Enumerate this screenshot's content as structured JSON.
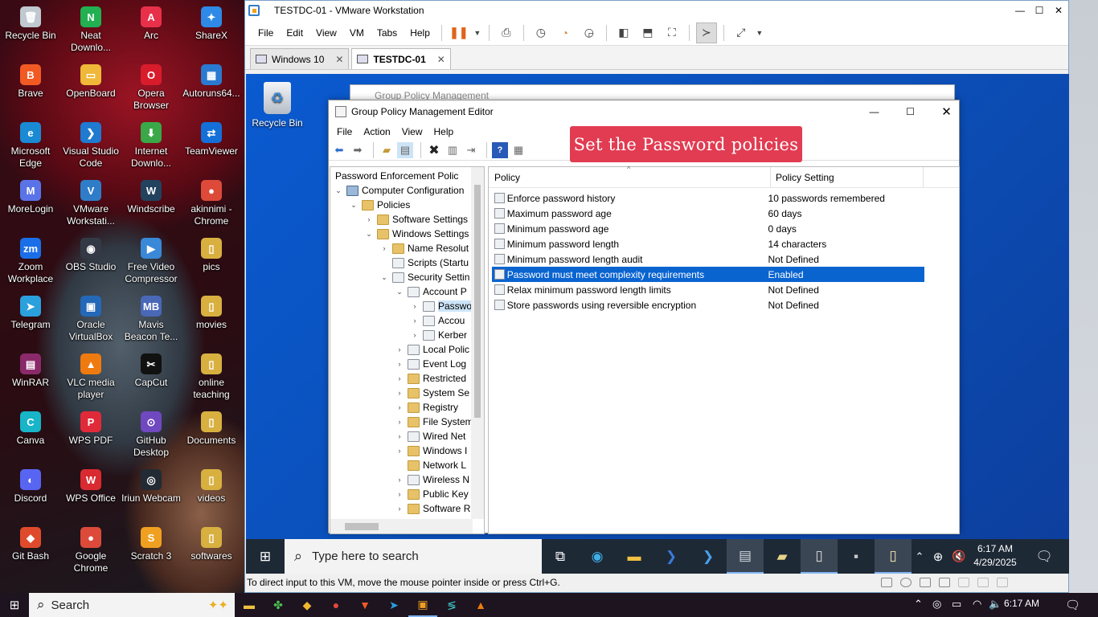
{
  "host_desktop": {
    "icons": [
      {
        "label": "Recycle Bin",
        "glyph": "🗑",
        "color": "#c0c8d0"
      },
      {
        "label": "Neat Downlo...",
        "glyph": "N",
        "color": "#22b052"
      },
      {
        "label": "Arc",
        "glyph": "A",
        "color": "#e8304a"
      },
      {
        "label": "ShareX",
        "glyph": "✦",
        "color": "#2e8ae6"
      },
      {
        "label": "Brave",
        "glyph": "B",
        "color": "#f25a24"
      },
      {
        "label": "OpenBoard",
        "glyph": "▭",
        "color": "#f0b838"
      },
      {
        "label": "Opera Browser",
        "glyph": "O",
        "color": "#d81c2c"
      },
      {
        "label": "Autoruns64...",
        "glyph": "▦",
        "color": "#2a7ad0"
      },
      {
        "label": "Microsoft Edge",
        "glyph": "e",
        "color": "#1a8ad4"
      },
      {
        "label": "Visual Studio Code",
        "glyph": "❯",
        "color": "#1f7ad0"
      },
      {
        "label": "Internet Downlo...",
        "glyph": "⬇",
        "color": "#3aa848"
      },
      {
        "label": "TeamViewer",
        "glyph": "⇄",
        "color": "#1470d8"
      },
      {
        "label": "MoreLogin",
        "glyph": "M",
        "color": "#5a74e8"
      },
      {
        "label": "VMware Workstati...",
        "glyph": "V",
        "color": "#2f7dc8"
      },
      {
        "label": "Windscribe",
        "glyph": "W",
        "color": "#23425e"
      },
      {
        "label": "akinnimi - Chrome",
        "glyph": "●",
        "color": "#dd4a3a"
      },
      {
        "label": "Zoom Workplace",
        "glyph": "zm",
        "color": "#1a6ee8"
      },
      {
        "label": "OBS Studio",
        "glyph": "◉",
        "color": "#333a46"
      },
      {
        "label": "Free Video Compressor",
        "glyph": "▶",
        "color": "#3a88d8"
      },
      {
        "label": "pics",
        "glyph": "▯",
        "color": "#d8b040"
      },
      {
        "label": "Telegram",
        "glyph": "➤",
        "color": "#2aa0dc"
      },
      {
        "label": "Oracle VirtualBox",
        "glyph": "▣",
        "color": "#2468b8"
      },
      {
        "label": "Mavis Beacon Te...",
        "glyph": "MB",
        "color": "#4a68b8"
      },
      {
        "label": "movies",
        "glyph": "▯",
        "color": "#d8b040"
      },
      {
        "label": "WinRAR",
        "glyph": "▤",
        "color": "#8a2a6a"
      },
      {
        "label": "VLC media player",
        "glyph": "▲",
        "color": "#ee7a10"
      },
      {
        "label": "CapCut",
        "glyph": "✂",
        "color": "#111111"
      },
      {
        "label": "online teaching",
        "glyph": "▯",
        "color": "#d8b040"
      },
      {
        "label": "Canva",
        "glyph": "C",
        "color": "#18b4c8"
      },
      {
        "label": "WPS PDF",
        "glyph": "P",
        "color": "#e02a3a"
      },
      {
        "label": "GitHub Desktop",
        "glyph": "⊙",
        "color": "#7048c0"
      },
      {
        "label": "Documents",
        "glyph": "▯",
        "color": "#d8b040"
      },
      {
        "label": "Discord",
        "glyph": "◐",
        "color": "#5865f2"
      },
      {
        "label": "WPS Office",
        "glyph": "W",
        "color": "#d82a30"
      },
      {
        "label": "Iriun Webcam",
        "glyph": "◎",
        "color": "#222a34"
      },
      {
        "label": "videos",
        "glyph": "▯",
        "color": "#d8b040"
      },
      {
        "label": "Git Bash",
        "glyph": "◆",
        "color": "#e04a2c"
      },
      {
        "label": "Google Chrome",
        "glyph": "●",
        "color": "#dd4a3a"
      },
      {
        "label": "Scratch 3",
        "glyph": "S",
        "color": "#f0a020"
      },
      {
        "label": "softwares",
        "glyph": "▯",
        "color": "#d8b040"
      }
    ]
  },
  "vmware": {
    "title": "TESTDC-01 - VMware Workstation",
    "menu": [
      "File",
      "Edit",
      "View",
      "VM",
      "Tabs",
      "Help"
    ],
    "tabs": [
      {
        "label": "Windows 10",
        "active": false
      },
      {
        "label": "TESTDC-01",
        "active": true
      }
    ],
    "status_text": "To direct input to this VM, move the mouse pointer inside or press Ctrl+G."
  },
  "guest": {
    "recycle_bin_label": "Recycle Bin",
    "gpm_back_title": "Group Policy Management",
    "gpme": {
      "title": "Group Policy Management Editor",
      "menu": [
        "File",
        "Action",
        "View",
        "Help"
      ],
      "callout": "Set the Password policies",
      "tree": [
        {
          "label": "Password Enforcement Polic",
          "depth": 0,
          "expander": "",
          "icon": "pol"
        },
        {
          "label": "Computer Configuration",
          "depth": 1,
          "expander": "⌄",
          "icon": "pc"
        },
        {
          "label": "Policies",
          "depth": 2,
          "expander": "⌄",
          "icon": "fold"
        },
        {
          "label": "Software Settings",
          "depth": 3,
          "expander": "›",
          "icon": "fold"
        },
        {
          "label": "Windows Settings",
          "depth": 3,
          "expander": "⌄",
          "icon": "fold"
        },
        {
          "label": "Name Resolut",
          "depth": 4,
          "expander": "›",
          "icon": "fold"
        },
        {
          "label": "Scripts (Startu",
          "depth": 4,
          "expander": "",
          "icon": "pol"
        },
        {
          "label": "Security Settin",
          "depth": 4,
          "expander": "⌄",
          "icon": "pol"
        },
        {
          "label": "Account P",
          "depth": 5,
          "expander": "⌄",
          "icon": "pol"
        },
        {
          "label": "Passwo",
          "depth": 6,
          "expander": "›",
          "icon": "pol",
          "selected": true
        },
        {
          "label": "Accou",
          "depth": 6,
          "expander": "›",
          "icon": "pol"
        },
        {
          "label": "Kerber",
          "depth": 6,
          "expander": "›",
          "icon": "pol"
        },
        {
          "label": "Local Polic",
          "depth": 5,
          "expander": "›",
          "icon": "pol"
        },
        {
          "label": "Event Log",
          "depth": 5,
          "expander": "›",
          "icon": "pol"
        },
        {
          "label": "Restricted",
          "depth": 5,
          "expander": "›",
          "icon": "fold"
        },
        {
          "label": "System Se",
          "depth": 5,
          "expander": "›",
          "icon": "fold"
        },
        {
          "label": "Registry",
          "depth": 5,
          "expander": "›",
          "icon": "fold"
        },
        {
          "label": "File System",
          "depth": 5,
          "expander": "›",
          "icon": "fold"
        },
        {
          "label": "Wired Net",
          "depth": 5,
          "expander": "›",
          "icon": "pol"
        },
        {
          "label": "Windows I",
          "depth": 5,
          "expander": "›",
          "icon": "fold"
        },
        {
          "label": "Network L",
          "depth": 5,
          "expander": "",
          "icon": "fold"
        },
        {
          "label": "Wireless N",
          "depth": 5,
          "expander": "›",
          "icon": "pol"
        },
        {
          "label": "Public Key",
          "depth": 5,
          "expander": "›",
          "icon": "fold"
        },
        {
          "label": "Software R",
          "depth": 5,
          "expander": "›",
          "icon": "fold"
        }
      ],
      "columns": {
        "policy": "Policy",
        "setting": "Policy Setting"
      },
      "rows": [
        {
          "policy": "Enforce password history",
          "setting": "10 passwords remembered",
          "selected": false
        },
        {
          "policy": "Maximum password age",
          "setting": "60 days",
          "selected": false
        },
        {
          "policy": "Minimum password age",
          "setting": "0 days",
          "selected": false
        },
        {
          "policy": "Minimum password length",
          "setting": "14 characters",
          "selected": false
        },
        {
          "policy": "Minimum password length audit",
          "setting": "Not Defined",
          "selected": false
        },
        {
          "policy": "Password must meet complexity requirements",
          "setting": "Enabled",
          "selected": true
        },
        {
          "policy": "Relax minimum password length limits",
          "setting": "Not Defined",
          "selected": false
        },
        {
          "policy": "Store passwords using reversible encryption",
          "setting": "Not Defined",
          "selected": false
        }
      ]
    },
    "taskbar": {
      "search_placeholder": "Type here to search",
      "time": "6:17 AM",
      "date": "4/29/2025"
    }
  },
  "host_taskbar": {
    "search_label": "Search",
    "time": "6:17 AM"
  },
  "colors": {
    "selection": "#0a64d0",
    "callout": "#e13c52",
    "guest_bg": "#0b4fb8"
  }
}
